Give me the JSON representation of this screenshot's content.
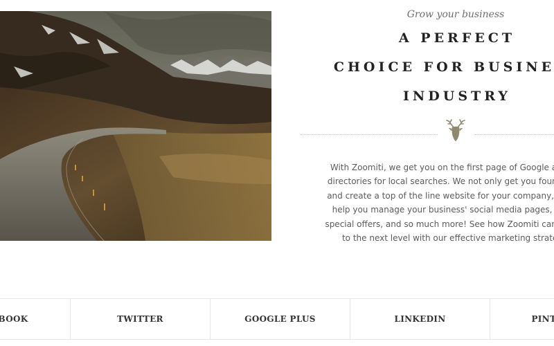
{
  "hero": {
    "tagline": "Grow your business",
    "headline_lines": [
      "A PERFECT",
      "CHOICE FOR BUSINESS",
      "INDUSTRY"
    ],
    "description_lines": [
      "With Zoomiti, we get you on the first page of Google and all",
      "directories for local searches. We not only get you found on s",
      "and create a top of the line website for your company, we als",
      "help you manage your business' social media pages, email",
      "special offers, and so much more! See how Zoomiti can take y",
      "to the next level with our effective marketing strategy"
    ]
  },
  "divider": {
    "icon": "deer-head-icon",
    "color": "#8f8a6e"
  },
  "social": [
    {
      "label": "FACEBOOK"
    },
    {
      "label": "TWITTER"
    },
    {
      "label": "GOOGLE PLUS"
    },
    {
      "label": "LINKEDIN"
    },
    {
      "label": "PINTEREST"
    }
  ]
}
